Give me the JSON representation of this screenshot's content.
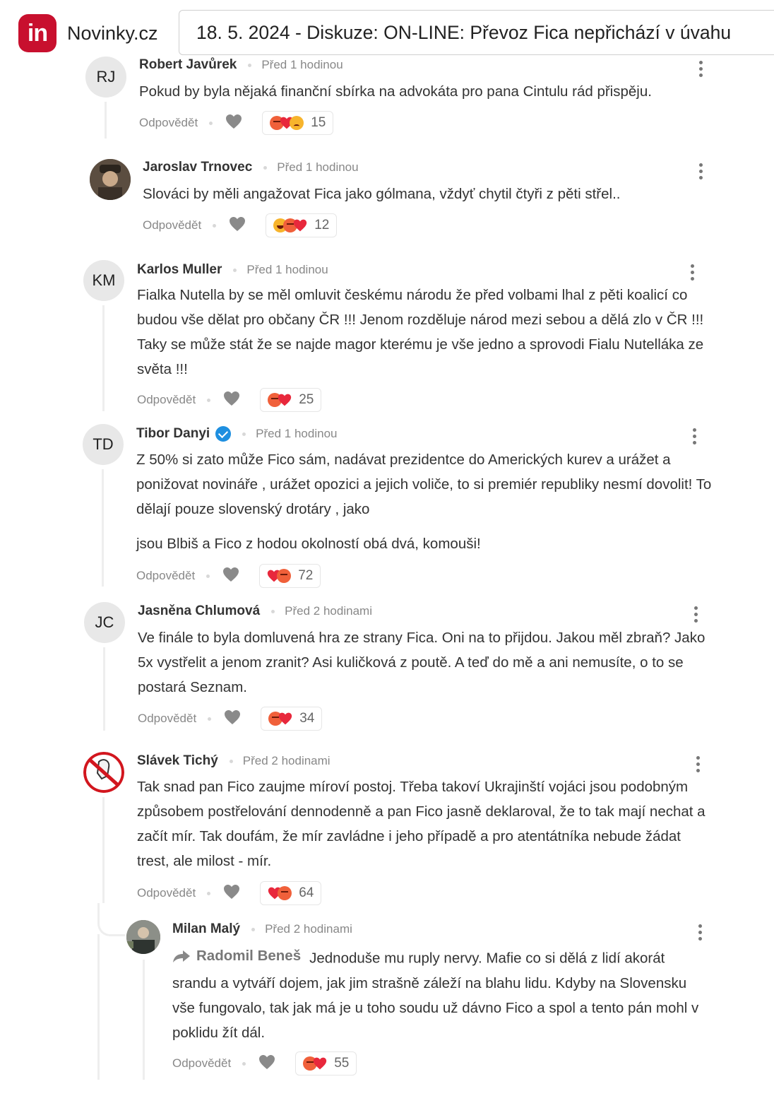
{
  "header": {
    "logo_text": "in",
    "site_name": "Novinky.cz",
    "headline": "18. 5. 2024 - Diskuze: ON-LINE: Převoz Fica nepřichází v úvahu"
  },
  "reply_label": "Odpovědět",
  "comments": [
    {
      "author": "Robert Javůrek",
      "initials": "RJ",
      "time": "Před 1 hodinou",
      "text": [
        "Pokud by byla nějaká finanční sbírka na advokáta pro pana Cintulu rád přispěju."
      ],
      "reactions": [
        "angry",
        "heart",
        "sad"
      ],
      "count": "15"
    },
    {
      "author": "Jaroslav Trnovec",
      "initials": "",
      "time": "Před 1 hodinou",
      "text": [
        "Slováci by měli angažovat Fica jako gólmana, vždyť chytil čtyři z pěti střel.."
      ],
      "reactions": [
        "laugh",
        "angry",
        "heart"
      ],
      "count": "12"
    },
    {
      "author": "Karlos Muller",
      "initials": "KM",
      "time": "Před 1 hodinou",
      "text": [
        "Fialka Nutella by se měl omluvit českému národu že před volbami lhal z pěti koalicí co budou vše dělat pro občany ČR !!! Jenom rozděluje národ mezi sebou a dělá zlo v ČR !!! Taky se může stát že se najde magor kterému je vše jedno a sprovodi Fialu Nutelláka ze světa !!!"
      ],
      "reactions": [
        "angry",
        "heart"
      ],
      "count": "25"
    },
    {
      "author": "Tibor Danyi",
      "initials": "TD",
      "time": "Před 1 hodinou",
      "text": [
        "Z 50% si zato může Fico sám, nadávat prezidentce do Amerických kurev a urážet a ponižovat novináře , urážet opozici a jejich voliče, to si premiér republiky nesmí dovolit! To dělají pouze slovenský drotáry , jako",
        "jsou Blbiš a Fico z hodou okolností obá dvá, komouši!"
      ],
      "reactions": [
        "heart",
        "angry"
      ],
      "count": "72"
    },
    {
      "author": "Jasněna Chlumová",
      "initials": "JC",
      "time": "Před 2 hodinami",
      "text": [
        "Ve finále to byla domluvená hra ze strany Fica. Oni na to přijdou. Jakou měl zbraň? Jako 5x vystřelit a jenom zranit? Asi kuličková z poutě. A teď do mě a ani nemusíte, o to se postará Seznam."
      ],
      "reactions": [
        "angry",
        "heart"
      ],
      "count": "34"
    },
    {
      "author": "Slávek Tichý",
      "initials": "",
      "time": "Před 2 hodinami",
      "text": [
        "Tak snad pan Fico zaujme míroví postoj. Třeba takoví Ukrajinští vojáci jsou podobným způsobem postřelování dennodenně a pan Fico jasně deklaroval, že to tak mají nechat a začít mír. Tak doufám, že mír zavládne i jeho případě a pro atentátníka nebude žádat trest, ale milost - mír."
      ],
      "reactions": [
        "heart",
        "angry"
      ],
      "count": "64"
    },
    {
      "author": "Milan Malý",
      "initials": "",
      "time": "Před 2 hodinami",
      "quoted_author": "Radomil Beneš",
      "text": [
        "Jednoduše mu ruply nervy. Mafie co si dělá z lidí akorát srandu a vytváří dojem, jak jim strašně záleží na blahu lidu. Kdyby na Slovensku vše fungovalo, tak jak má je u toho soudu už dávno Fico a spol a tento pán mohl v poklidu žít dál."
      ],
      "reactions": [
        "angry",
        "heart"
      ],
      "count": "55"
    }
  ]
}
